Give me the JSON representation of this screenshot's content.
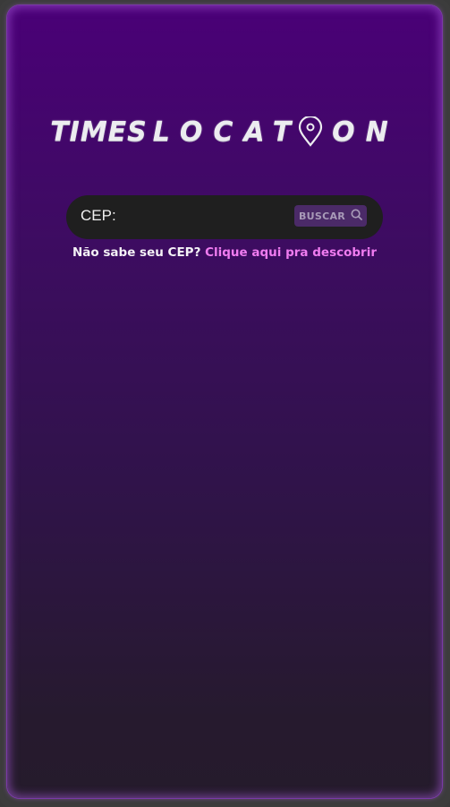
{
  "logo": {
    "word1": "TIMES",
    "word2_part1": "LOCAT",
    "word2_part2": "ON",
    "pin_icon": "map-pin-icon"
  },
  "search": {
    "label": "CEP:",
    "value": "",
    "placeholder": "",
    "button_label": "BUSCAR",
    "button_icon": "search-icon"
  },
  "hint": {
    "text": "Não sabe seu CEP?",
    "link": "Clique aqui pra descobrir"
  },
  "colors": {
    "background_top": "#4a0077",
    "background_bottom": "#251b2c",
    "search_bar": "#1f1f1f",
    "button": "#4b2a68",
    "link": "#f07cf0"
  }
}
